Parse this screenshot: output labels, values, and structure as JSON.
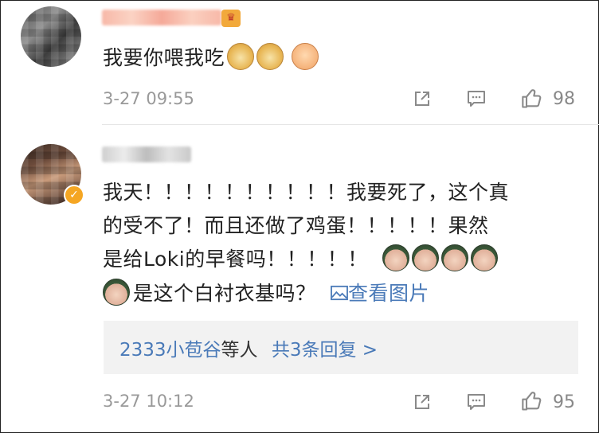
{
  "comments": [
    {
      "text_line1": "我要你喂我吃",
      "emojis": [
        "doge-emoji",
        "doge-emoji",
        "fist-emoji"
      ],
      "timestamp": "3-27 09:55",
      "like_count": "98"
    },
    {
      "text_lines": [
        "我天！！！！！！！！！！我要死了，这个真",
        "的受不了！而且还做了鸡蛋！！！！！果然",
        "是给Loki的早餐吗！！！！！",
        "是这个白衬衣基吗？"
      ],
      "view_image_label": "查看图片",
      "replies": {
        "users": "2333小苞谷",
        "suffix": "等人",
        "count_label": "共3条回复 >"
      },
      "timestamp": "3-27 10:12",
      "like_count": "95"
    }
  ],
  "colors": {
    "link": "#4a7ab8",
    "meta": "#999999",
    "badge": "#f5a623"
  },
  "icons": {
    "share": "share-icon",
    "comment": "comment-icon",
    "like": "thumbs-up-icon",
    "image": "image-icon",
    "verified": "verified-badge-icon"
  }
}
